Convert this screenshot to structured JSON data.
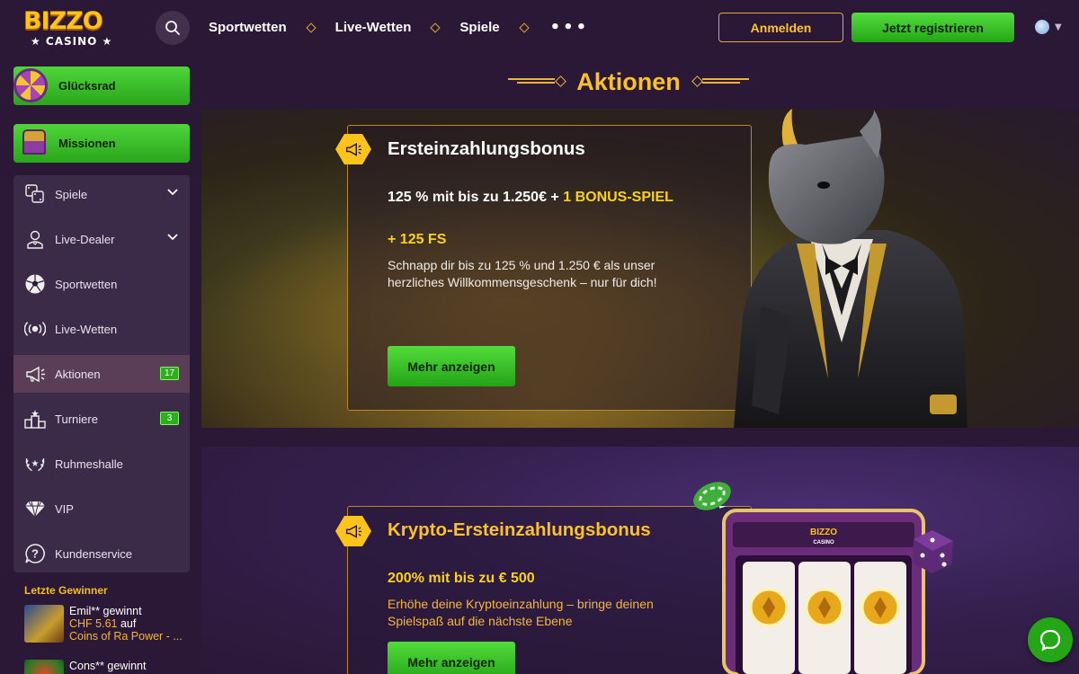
{
  "brand": {
    "name": "BIZZO",
    "sub": "★ CASINO ★"
  },
  "header": {
    "nav": [
      "Sportwetten",
      "Live-Wetten",
      "Spiele"
    ],
    "more": "•••",
    "login": "Anmelden",
    "register": "Jetzt registrieren"
  },
  "sidebar": {
    "wheel": "Glücksrad",
    "missions": "Missionen",
    "items": [
      {
        "label": "Spiele",
        "icon": "games-icon",
        "expandable": true
      },
      {
        "label": "Live-Dealer",
        "icon": "dealer-icon",
        "expandable": true
      },
      {
        "label": "Sportwetten",
        "icon": "soccer-ball-icon"
      },
      {
        "label": "Live-Wetten",
        "icon": "live-broadcast-icon"
      },
      {
        "label": "Aktionen",
        "icon": "megaphone-icon",
        "badge": "17",
        "active": true
      },
      {
        "label": "Turniere",
        "icon": "podium-icon",
        "badge": "3"
      },
      {
        "label": "Ruhmeshalle",
        "icon": "laurel-icon"
      },
      {
        "label": "VIP",
        "icon": "diamond-icon"
      },
      {
        "label": "Kundenservice",
        "icon": "help-icon"
      }
    ],
    "winners_title": "Letzte Gewinner",
    "winners": [
      {
        "name": "Emil** gewinnt",
        "amount": "CHF 5.61",
        "on": "auf",
        "game": "Coins of Ra Power - ..."
      },
      {
        "name": "Cons** gewinnt",
        "amount": "",
        "on": "",
        "game": ""
      }
    ]
  },
  "main": {
    "title": "Aktionen",
    "promos": [
      {
        "title": "Ersteinzahlungsbonus",
        "offer_a": "125 % mit bis zu 1.250€ + ",
        "offer_highlight": "1 BONUS-SPIEL",
        "offer_b": "+ 125 FS",
        "desc": "Schnapp dir bis zu 125 % und 1.250 € als unser herzliches Willkommensgeschenk – nur für dich!",
        "cta": "Mehr anzeigen"
      },
      {
        "title": "Krypto-Ersteinzahlungsbonus",
        "offer": "200% mit bis zu € 500",
        "desc": "Erhöhe deine Kryptoeinzahlung – bringe deinen Spielspaß auf die nächste Ebene",
        "cta": "Mehr anzeigen"
      }
    ]
  },
  "slot_logo": {
    "main": "BIZZO",
    "sub": "CASINO"
  },
  "colors": {
    "accent": "#fbc12a",
    "green": "#2aa51c",
    "bg": "#2b1836",
    "panel": "#3c2b48"
  }
}
